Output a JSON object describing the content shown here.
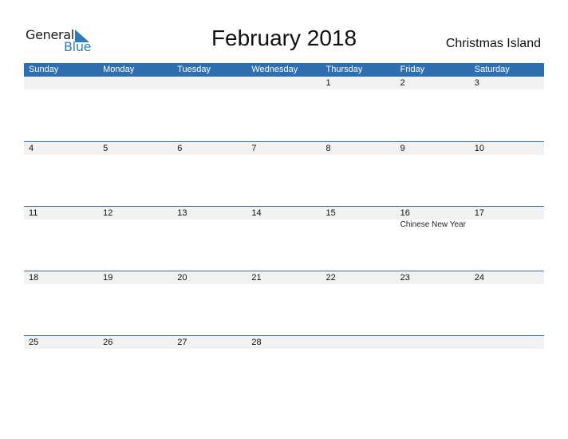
{
  "logo": {
    "line1": "General",
    "line2": "Blue",
    "accent_color": "#2b7bbd"
  },
  "title": "February 2018",
  "country": "Christmas Island",
  "header_color": "#2e6fb0",
  "weekdays": [
    "Sunday",
    "Monday",
    "Tuesday",
    "Wednesday",
    "Thursday",
    "Friday",
    "Saturday"
  ],
  "weeks": [
    {
      "days": [
        {
          "date": "",
          "event": ""
        },
        {
          "date": "",
          "event": ""
        },
        {
          "date": "",
          "event": ""
        },
        {
          "date": "",
          "event": ""
        },
        {
          "date": "1",
          "event": ""
        },
        {
          "date": "2",
          "event": ""
        },
        {
          "date": "3",
          "event": ""
        }
      ]
    },
    {
      "days": [
        {
          "date": "4",
          "event": ""
        },
        {
          "date": "5",
          "event": ""
        },
        {
          "date": "6",
          "event": ""
        },
        {
          "date": "7",
          "event": ""
        },
        {
          "date": "8",
          "event": ""
        },
        {
          "date": "9",
          "event": ""
        },
        {
          "date": "10",
          "event": ""
        }
      ]
    },
    {
      "days": [
        {
          "date": "11",
          "event": ""
        },
        {
          "date": "12",
          "event": ""
        },
        {
          "date": "13",
          "event": ""
        },
        {
          "date": "14",
          "event": ""
        },
        {
          "date": "15",
          "event": ""
        },
        {
          "date": "16",
          "event": "Chinese New Year"
        },
        {
          "date": "17",
          "event": ""
        }
      ]
    },
    {
      "days": [
        {
          "date": "18",
          "event": ""
        },
        {
          "date": "19",
          "event": ""
        },
        {
          "date": "20",
          "event": ""
        },
        {
          "date": "21",
          "event": ""
        },
        {
          "date": "22",
          "event": ""
        },
        {
          "date": "23",
          "event": ""
        },
        {
          "date": "24",
          "event": ""
        }
      ]
    },
    {
      "days": [
        {
          "date": "25",
          "event": ""
        },
        {
          "date": "26",
          "event": ""
        },
        {
          "date": "27",
          "event": ""
        },
        {
          "date": "28",
          "event": ""
        },
        {
          "date": "",
          "event": ""
        },
        {
          "date": "",
          "event": ""
        },
        {
          "date": "",
          "event": ""
        }
      ]
    }
  ]
}
